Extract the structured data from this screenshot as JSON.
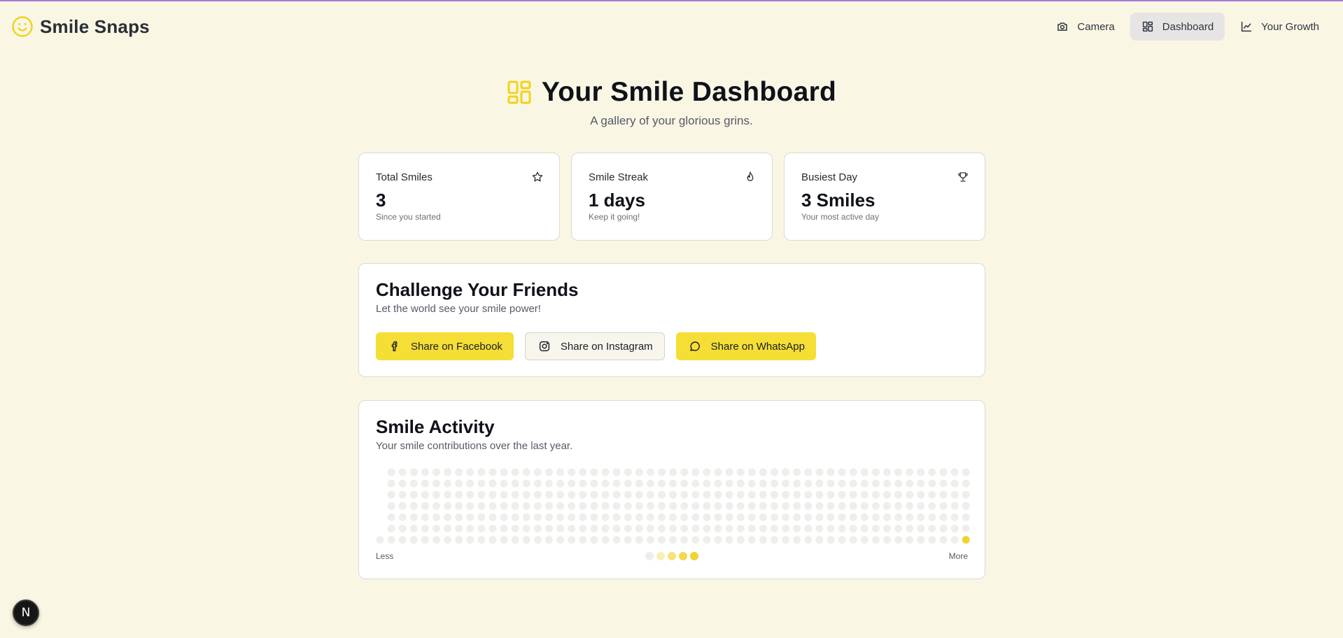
{
  "app": {
    "name": "Smile Snaps",
    "logo_icon": "smile-icon"
  },
  "nav": [
    {
      "label": "Camera",
      "icon": "camera-icon",
      "active": false
    },
    {
      "label": "Dashboard",
      "icon": "grid-icon",
      "active": true
    },
    {
      "label": "Your Growth",
      "icon": "line-chart-icon",
      "active": false
    }
  ],
  "page": {
    "title": "Your Smile Dashboard",
    "subtitle": "A gallery of your glorious grins.",
    "title_icon": "dashboard-grid-icon"
  },
  "stats": [
    {
      "label": "Total Smiles",
      "value": "3",
      "note": "Since you started",
      "icon": "star-icon"
    },
    {
      "label": "Smile Streak",
      "value": "1 days",
      "note": "Keep it going!",
      "icon": "flame-icon"
    },
    {
      "label": "Busiest Day",
      "value": "3 Smiles",
      "note": "Your most active day",
      "icon": "trophy-icon"
    }
  ],
  "challenge": {
    "title": "Challenge Your Friends",
    "subtitle": "Let the world see your smile power!",
    "buttons": [
      {
        "label": "Share on Facebook",
        "icon": "facebook-icon"
      },
      {
        "label": "Share on Instagram",
        "icon": "instagram-icon"
      },
      {
        "label": "Share on WhatsApp",
        "icon": "whatsapp-icon"
      }
    ]
  },
  "activity": {
    "title": "Smile Activity",
    "subtitle": "Your smile contributions over the last year.",
    "legend_less": "Less",
    "legend_more": "More",
    "weeks": 53,
    "days_per_week": 7,
    "first_week_start_day": 6,
    "active_days": [
      {
        "week": 52,
        "day": 6,
        "level": 4
      }
    ],
    "level_colors": [
      "#efeeea",
      "#f7efb6",
      "#f4e47b",
      "#f1da4c",
      "#efd331"
    ]
  },
  "colors": {
    "accent": "#f5de35",
    "background": "#f9f6e4",
    "brand_icon": "#f2d21a"
  },
  "framework_badge": {
    "letter": "N"
  }
}
